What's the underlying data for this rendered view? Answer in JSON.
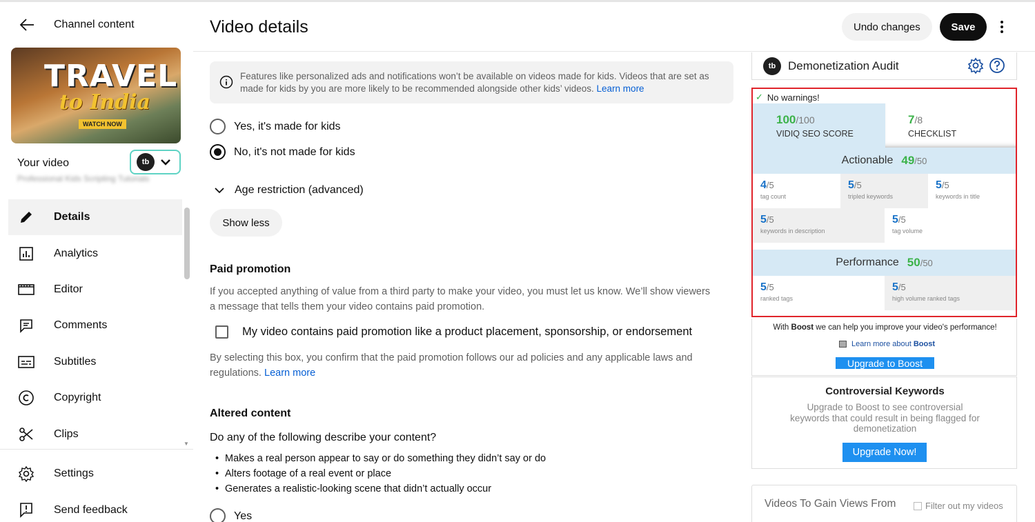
{
  "header": {
    "back_label": "Channel content",
    "page_title": "Video details",
    "undo_label": "Undo changes",
    "save_label": "Save"
  },
  "sidebar": {
    "thumbnail": {
      "title": "TRAVEL",
      "script": "to India",
      "cta": "WATCH NOW"
    },
    "your_video_label": "Your video",
    "video_name_blurred": "Professional Kids Scripting Tutorials",
    "extension_logo": "tb",
    "items": [
      {
        "label": "Details",
        "icon": "pencil-icon",
        "active": true
      },
      {
        "label": "Analytics",
        "icon": "analytics-icon",
        "active": false
      },
      {
        "label": "Editor",
        "icon": "editor-icon",
        "active": false
      },
      {
        "label": "Comments",
        "icon": "comments-icon",
        "active": false
      },
      {
        "label": "Subtitles",
        "icon": "subtitles-icon",
        "active": false
      },
      {
        "label": "Copyright",
        "icon": "copyright-icon",
        "active": false
      },
      {
        "label": "Clips",
        "icon": "scissors-icon",
        "active": false
      }
    ],
    "bottom_items": [
      {
        "label": "Settings",
        "icon": "gear-icon"
      },
      {
        "label": "Send feedback",
        "icon": "feedback-icon"
      }
    ]
  },
  "main": {
    "info_text": "Features like personalized ads and notifications won’t be available on videos made for kids. Videos that are set as made for kids by you are more likely to be recommended alongside other kids’ videos.",
    "info_link": "Learn more",
    "kids_options": [
      {
        "label": "Yes, it's made for kids",
        "selected": false
      },
      {
        "label": "No, it's not made for kids",
        "selected": true
      }
    ],
    "age_restriction_label": "Age restriction (advanced)",
    "show_less_label": "Show less",
    "paid_promotion": {
      "title": "Paid promotion",
      "description": "If you accepted anything of value from a third party to make your video, you must let us know. We’ll show viewers a message that tells them your video contains paid promotion.",
      "checkbox_label": "My video contains paid promotion like a product placement, sponsorship, or endorsement",
      "checked": false,
      "note": "By selecting this box, you confirm that the paid promotion follows our ad policies and any applicable laws and regulations.",
      "note_link": "Learn more"
    },
    "altered_content": {
      "title": "Altered content",
      "question": "Do any of the following describe your content?",
      "bullets": [
        "Makes a real person appear to say or do something they didn’t say or do",
        "Alters footage of a real event or place",
        "Generates a realistic-looking scene that didn’t actually occur"
      ],
      "yes_label": "Yes"
    }
  },
  "right_panel": {
    "title": "Demonetization Audit",
    "no_warnings": "No warnings!",
    "seo_score": {
      "value": "100",
      "denominator": "/100",
      "label": "VIDIQ SEO SCORE"
    },
    "checklist": {
      "value": "7",
      "denominator": "/8",
      "label": "CHECKLIST"
    },
    "actionable": {
      "label": "Actionable",
      "value": "49",
      "denominator": "/50"
    },
    "actionable_cells": [
      {
        "value": "4",
        "den": "/5",
        "label": "tag count"
      },
      {
        "value": "5",
        "den": "/5",
        "label": "tripled keywords"
      },
      {
        "value": "5",
        "den": "/5",
        "label": "keywords in title"
      },
      {
        "value": "5",
        "den": "/5",
        "label": "keywords in description"
      },
      {
        "value": "5",
        "den": "/5",
        "label": "tag volume"
      }
    ],
    "performance": {
      "label": "Performance",
      "value": "50",
      "denominator": "/50"
    },
    "performance_cells": [
      {
        "value": "5",
        "den": "/5",
        "label": "ranked tags"
      },
      {
        "value": "5",
        "den": "/5",
        "label": "high volume ranked tags"
      }
    ],
    "boost_pre": "With ",
    "boost_word": "Boost",
    "boost_post": " we can help you improve your video's performance!",
    "learn_more_boost_pre": "Learn more about ",
    "learn_more_boost_word": "Boost",
    "upgrade_boost_label": "Upgrade to Boost",
    "controversial_title": "Controversial Keywords",
    "controversial_desc": "Upgrade to Boost to see controversial keywords that could result in being flagged for demonetization",
    "upgrade_now_label": "Upgrade Now!",
    "gain_title": "Videos To Gain Views From",
    "filter_label": "Filter out my videos"
  },
  "colors": {
    "accent_green": "#3cb34a",
    "accent_blue": "#1e90f0",
    "highlight_red": "#e0242b",
    "link_blue": "#065fd4"
  }
}
